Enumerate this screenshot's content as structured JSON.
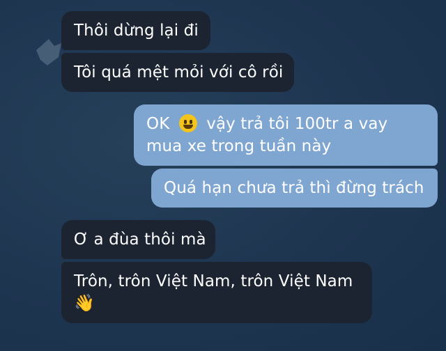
{
  "messages": [
    {
      "direction": "incoming",
      "text": "Thôi dừng lại đi"
    },
    {
      "direction": "incoming",
      "text": "Tôi quá mệt mỏi với cô rồi"
    },
    {
      "direction": "outgoing",
      "before_emoji": "OK",
      "emoji": "grinning-face-emoji",
      "after_emoji": "vậy trả tôi 100tr a vay mua xe trong tuần này"
    },
    {
      "direction": "outgoing",
      "text": "Quá hạn chưa trả thì đừng trách"
    },
    {
      "direction": "incoming",
      "text": "Ơ a đùa thôi mà"
    },
    {
      "direction": "incoming",
      "text": "Trôn, trôn Việt Nam, trôn Việt Nam",
      "emoji": "waving-hand-emoji",
      "emoji_char": "👋"
    }
  ],
  "colors": {
    "background": "#1e3550",
    "incoming_bubble": "#1b2430",
    "outgoing_bubble": "#7fa6d0",
    "text": "#ffffff"
  }
}
